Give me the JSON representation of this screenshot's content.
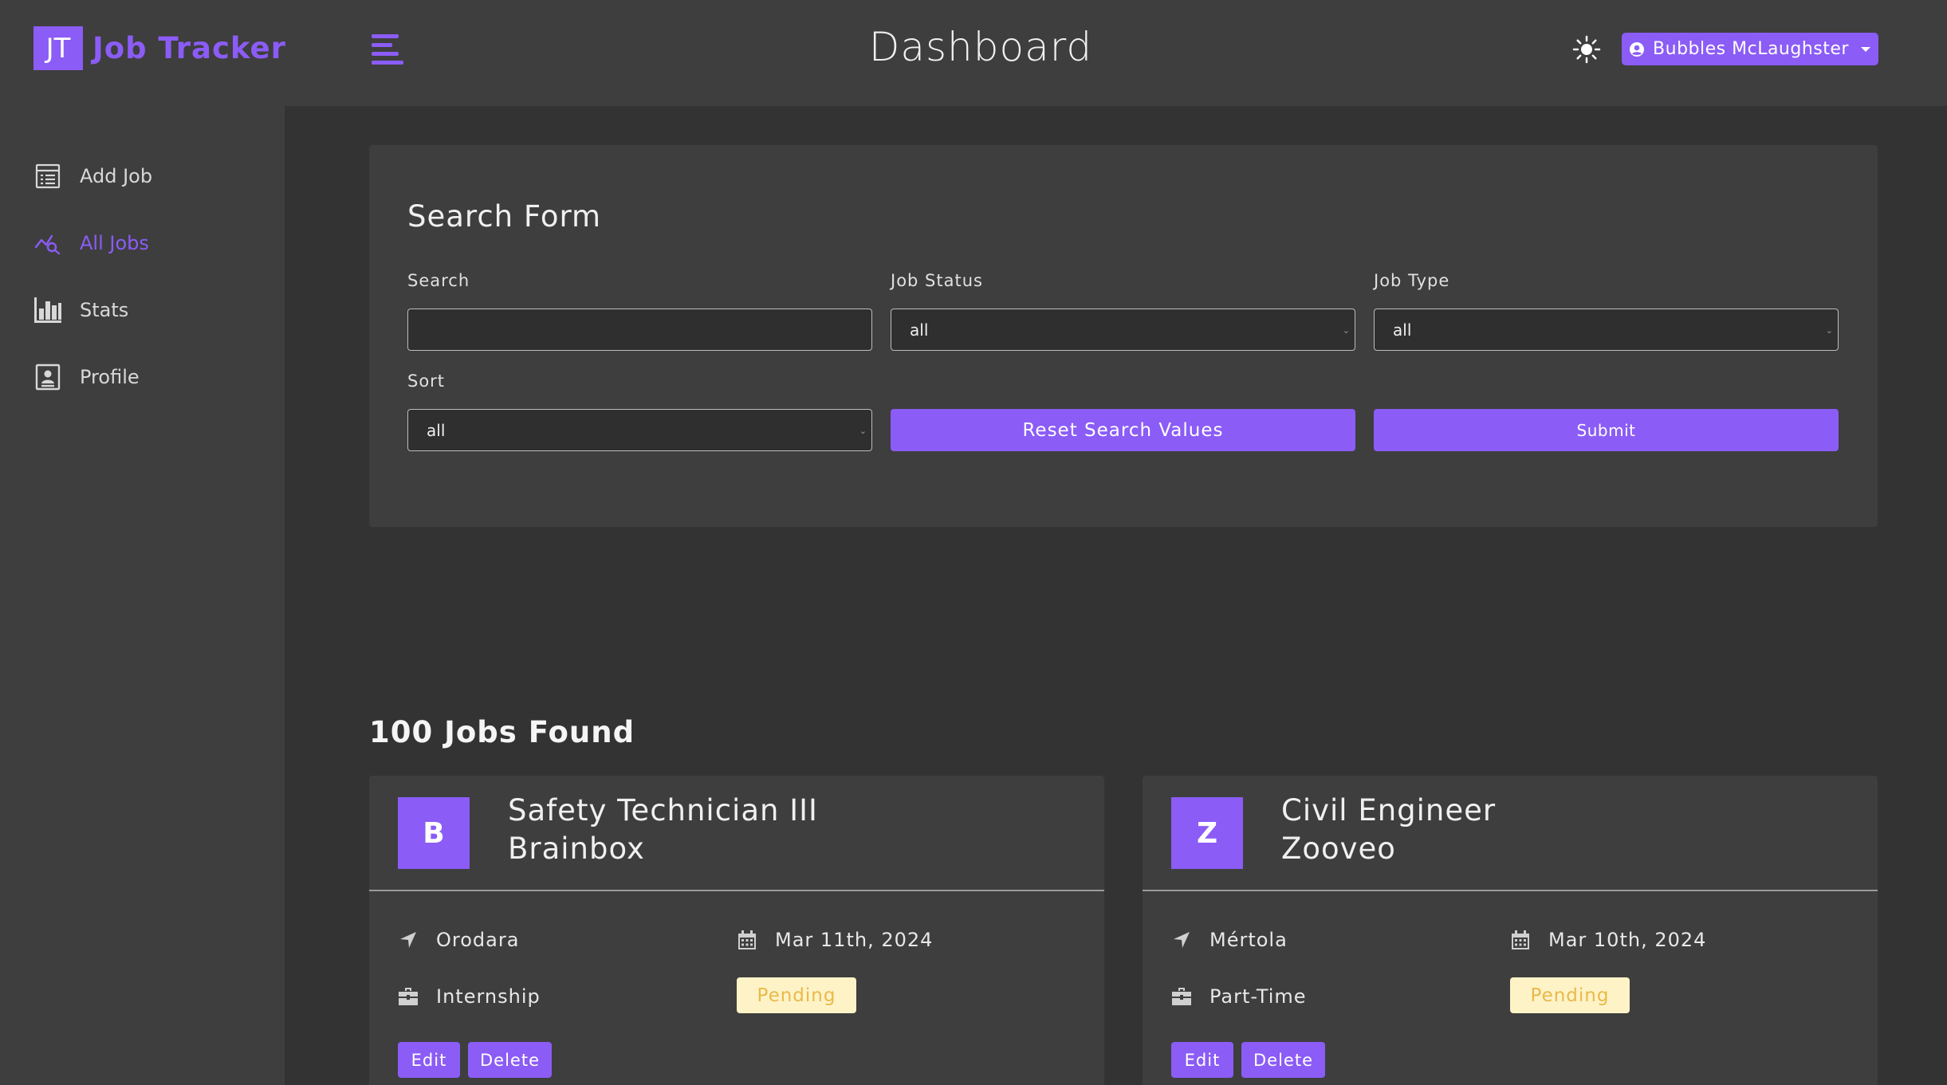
{
  "app": {
    "logo_initials": "JT",
    "logo_name": "Job Tracker"
  },
  "header": {
    "title": "Dashboard",
    "user_name": "Bubbles McLaughster"
  },
  "sidebar": {
    "items": [
      {
        "label": "Add Job",
        "icon": "add-job-icon",
        "active": false
      },
      {
        "label": "All Jobs",
        "icon": "all-jobs-icon",
        "active": true
      },
      {
        "label": "Stats",
        "icon": "stats-icon",
        "active": false
      },
      {
        "label": "Profile",
        "icon": "profile-icon",
        "active": false
      }
    ]
  },
  "search_form": {
    "title": "Search Form",
    "search_label": "Search",
    "search_value": "",
    "status_label": "Job Status",
    "status_value": "all",
    "type_label": "Job Type",
    "type_value": "all",
    "sort_label": "Sort",
    "sort_value": "all",
    "reset_label": "Reset Search Values",
    "submit_label": "Submit"
  },
  "results": {
    "count_text": "100 Jobs Found"
  },
  "jobs": [
    {
      "initial": "B",
      "position": "Safety Technician III",
      "company": "Brainbox",
      "location": "Orodara",
      "date": "Mar 11th, 2024",
      "type": "Internship",
      "status": "Pending",
      "edit_label": "Edit",
      "delete_label": "Delete"
    },
    {
      "initial": "Z",
      "position": "Civil Engineer",
      "company": "Zooveo",
      "location": "Mértola",
      "date": "Mar 10th, 2024",
      "type": "Part-Time",
      "status": "Pending",
      "edit_label": "Edit",
      "delete_label": "Delete"
    }
  ],
  "colors": {
    "accent": "#8b5cf6",
    "background": "#333333",
    "panel": "#3e3e3e",
    "pending_bg": "#fef3c7",
    "pending_text": "#e9b949"
  }
}
